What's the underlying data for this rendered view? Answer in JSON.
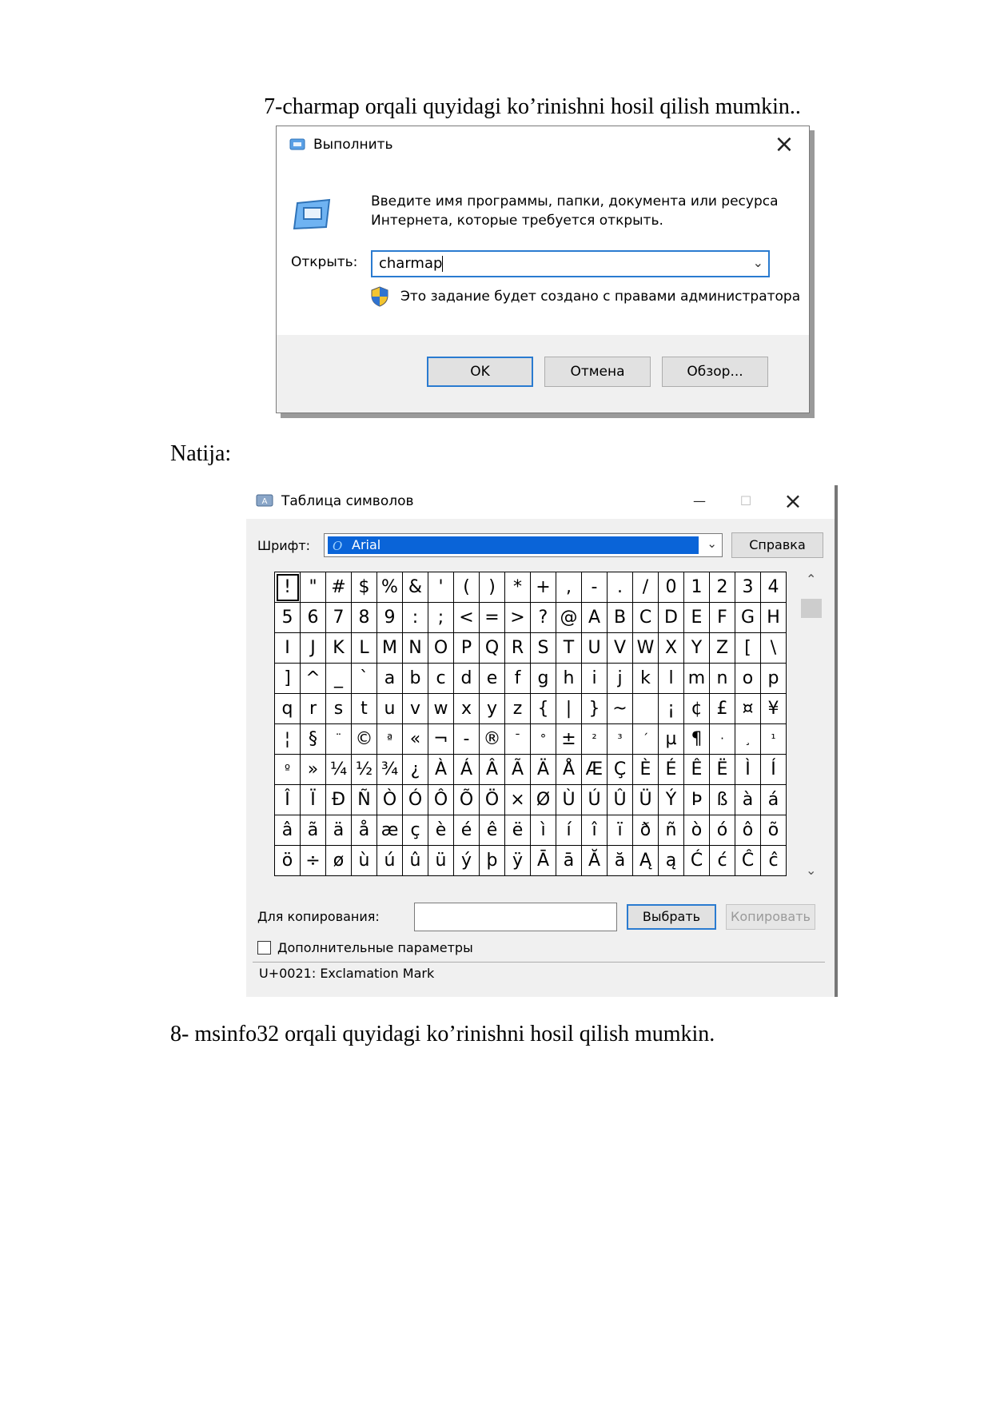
{
  "heading_7": "7-charmap orqali quyidagi ko’rinishni hosil qilish mumkin..",
  "run_dialog": {
    "title": "Выполнить",
    "close": "×",
    "description_line1": "Введите имя программы, папки, документа или ресурса",
    "description_line2": "Интернета, которые требуется открыть.",
    "open_label": "Открыть:",
    "open_value": "charmap",
    "admin_note": "Это задание будет создано с правами администратора",
    "ok_label": "OK",
    "cancel_label": "Отмена",
    "browse_label": "Обзор..."
  },
  "result_label": "Natija:",
  "charmap": {
    "title": "Таблица символов",
    "minimize": "—",
    "maximize": "☐",
    "close": "×",
    "font_label": "Шрифт:",
    "font_value": "Arial",
    "help_label": "Справка",
    "grid": [
      [
        "!",
        "\"",
        "#",
        "$",
        "%",
        "&",
        "'",
        "(",
        ")",
        "*",
        "+",
        ",",
        "-",
        ".",
        "/",
        "0",
        "1",
        "2",
        "3",
        "4"
      ],
      [
        "5",
        "6",
        "7",
        "8",
        "9",
        ":",
        ";",
        "<",
        "=",
        ">",
        "?",
        "@",
        "A",
        "B",
        "C",
        "D",
        "E",
        "F",
        "G",
        "H"
      ],
      [
        "I",
        "J",
        "K",
        "L",
        "M",
        "N",
        "O",
        "P",
        "Q",
        "R",
        "S",
        "T",
        "U",
        "V",
        "W",
        "X",
        "Y",
        "Z",
        "[",
        "\\"
      ],
      [
        "]",
        "^",
        "_",
        "`",
        "a",
        "b",
        "c",
        "d",
        "e",
        "f",
        "g",
        "h",
        "i",
        "j",
        "k",
        "l",
        "m",
        "n",
        "o",
        "p"
      ],
      [
        "q",
        "r",
        "s",
        "t",
        "u",
        "v",
        "w",
        "x",
        "y",
        "z",
        "{",
        "|",
        "}",
        "~",
        " ",
        "¡",
        "¢",
        "£",
        "¤",
        "¥"
      ],
      [
        "¦",
        "§",
        "¨",
        "©",
        "ª",
        "«",
        "¬",
        "-",
        "®",
        "¯",
        "°",
        "±",
        "²",
        "³",
        "´",
        "µ",
        "¶",
        "·",
        "¸",
        "¹"
      ],
      [
        "º",
        "»",
        "¼",
        "½",
        "¾",
        "¿",
        "À",
        "Á",
        "Â",
        "Ã",
        "Ä",
        "Å",
        "Æ",
        "Ç",
        "È",
        "É",
        "Ê",
        "Ë",
        "Ì",
        "Í"
      ],
      [
        "Î",
        "Ï",
        "Ð",
        "Ñ",
        "Ò",
        "Ó",
        "Ô",
        "Õ",
        "Ö",
        "×",
        "Ø",
        "Ù",
        "Ú",
        "Û",
        "Ü",
        "Ý",
        "Þ",
        "ß",
        "à",
        "á"
      ],
      [
        "â",
        "ã",
        "ä",
        "å",
        "æ",
        "ç",
        "è",
        "é",
        "ê",
        "ë",
        "ì",
        "í",
        "î",
        "ï",
        "ð",
        "ñ",
        "ò",
        "ó",
        "ô",
        "õ"
      ],
      [
        "ö",
        "÷",
        "ø",
        "ù",
        "ú",
        "û",
        "ü",
        "ý",
        "þ",
        "ÿ",
        "Ā",
        "ā",
        "Ă",
        "ă",
        "Ą",
        "ą",
        "Ć",
        "ć",
        "Ĉ",
        "ĉ"
      ]
    ],
    "selected_char": "!",
    "copy_label": "Для копирования:",
    "copy_value": "",
    "select_label": "Выбрать",
    "copy_button_label": "Копировать",
    "advanced_label": "Дополнительные параметры",
    "advanced_checked": false,
    "status_text": "U+0021: Exclamation Mark"
  },
  "heading_8": "8- msinfo32 orqali quyidagi ko’rinishni hosil qilish mumkin.",
  "colors": {
    "accent": "#2a7bd0",
    "selection": "#0a64d8"
  },
  "icons": [
    "run-icon",
    "close-icon",
    "chevron-down-icon",
    "shield-icon",
    "charmap-icon",
    "font-icon",
    "scroll-up-icon",
    "scroll-down-icon",
    "checkbox-icon"
  ]
}
